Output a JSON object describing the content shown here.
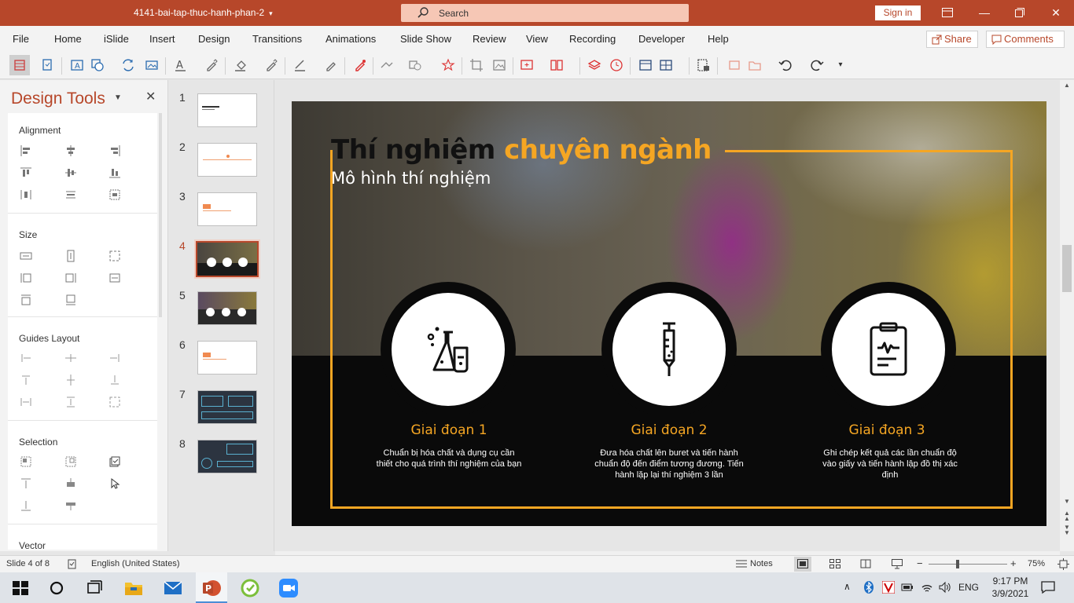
{
  "window": {
    "doc_title": "4141-bai-tap-thuc-hanh-phan-2",
    "search_placeholder": "Search",
    "signin_label": "Sign in",
    "share_label": "Share",
    "comments_label": "Comments",
    "accent_color": "#b7472a"
  },
  "ribbon": {
    "tabs": [
      "File",
      "Home",
      "iSlide",
      "Insert",
      "Design",
      "Transitions",
      "Animations",
      "Slide Show",
      "Review",
      "View",
      "Recording",
      "Developer",
      "Help"
    ]
  },
  "design_pane": {
    "title": "Design Tools",
    "groups": [
      "Alignment",
      "Size",
      "Guides Layout",
      "Selection",
      "Vector"
    ]
  },
  "thumbnails": {
    "numbers": [
      "1",
      "2",
      "3",
      "4",
      "5",
      "6",
      "7",
      "8"
    ],
    "selected": "4"
  },
  "slide": {
    "title_dark": "Thí nghiệm",
    "title_accent": "chuyên ngành",
    "subtitle": "Mô hình thí nghiệm",
    "accent_color": "#f5a623",
    "stages": [
      {
        "title": "Giai đoạn 1",
        "desc": "Chuẩn bị hóa chất và dụng cụ cần thiết cho quá trình thí nghiệm của bạn",
        "icon": "chemistry-flasks-icon"
      },
      {
        "title": "Giai đoạn 2",
        "desc": "Đưa hóa chất lên buret và tiến hành chuẩn độ đến điểm tương đương. Tiến hành lặp lại thí nghiệm 3 lần",
        "icon": "syringe-icon"
      },
      {
        "title": "Giai đoạn 3",
        "desc": "Ghi chép kết quả các lần chuẩn độ vào giấy và tiến hành lập đồ thị xác định",
        "icon": "clipboard-chart-icon"
      }
    ]
  },
  "status": {
    "slide_info": "Slide 4 of 8",
    "language": "English (United States)",
    "notes_label": "Notes",
    "zoom": "75%"
  },
  "taskbar": {
    "lang": "ENG",
    "time": "9:17 PM",
    "date": "3/9/2021"
  }
}
